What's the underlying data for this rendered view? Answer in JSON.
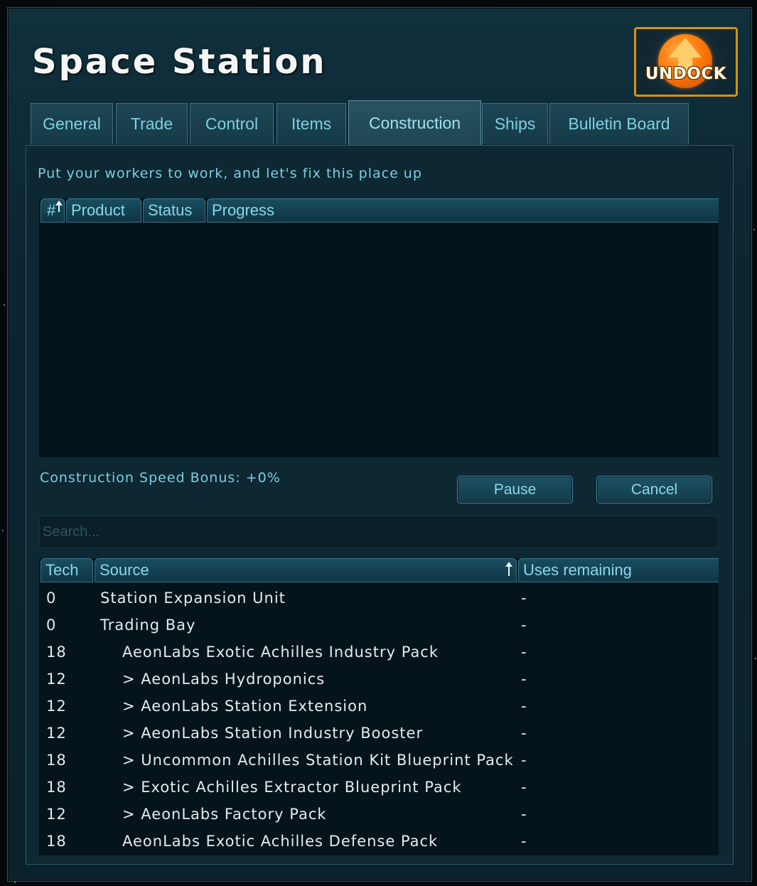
{
  "window": {
    "title": "Space Station"
  },
  "undock": {
    "label": "UNDOCK"
  },
  "tabs": [
    {
      "label": "General"
    },
    {
      "label": "Trade"
    },
    {
      "label": "Control"
    },
    {
      "label": "Items"
    },
    {
      "label": "Construction",
      "active": true
    },
    {
      "label": "Ships"
    },
    {
      "label": "Bulletin Board"
    }
  ],
  "construction": {
    "tagline": "Put your workers to work, and let's fix this place up",
    "queue_table": {
      "columns": [
        "#",
        "Product",
        "Status",
        "Progress"
      ],
      "sorted_by": "#",
      "rows": []
    },
    "speed_bonus": "Construction Speed Bonus: +0%",
    "buttons": {
      "pause": "Pause",
      "cancel": "Cancel"
    },
    "search": {
      "placeholder": "Search...",
      "value": ""
    },
    "source_table": {
      "columns": [
        "Tech",
        "Source",
        "Uses remaining"
      ],
      "sorted_by": "Source",
      "rows": [
        {
          "tech": "0",
          "source": "Station Expansion Unit",
          "indent": 0,
          "uses": "-"
        },
        {
          "tech": "0",
          "source": "Trading Bay",
          "indent": 0,
          "uses": "-"
        },
        {
          "tech": "18",
          "source": "AeonLabs Exotic Achilles Industry Pack",
          "indent": 1,
          "uses": "-"
        },
        {
          "tech": "12",
          "source": "> AeonLabs Hydroponics",
          "indent": 1,
          "uses": "-"
        },
        {
          "tech": "12",
          "source": "> AeonLabs Station Extension",
          "indent": 1,
          "uses": "-"
        },
        {
          "tech": "12",
          "source": "> AeonLabs Station Industry Booster",
          "indent": 1,
          "uses": "-"
        },
        {
          "tech": "18",
          "source": "> Uncommon Achilles Station Kit Blueprint Pack",
          "indent": 1,
          "uses": "-"
        },
        {
          "tech": "18",
          "source": "> Exotic Achilles Extractor Blueprint Pack",
          "indent": 1,
          "uses": "-"
        },
        {
          "tech": "12",
          "source": "> AeonLabs Factory Pack",
          "indent": 1,
          "uses": "-"
        },
        {
          "tech": "18",
          "source": "AeonLabs Exotic Achilles Defense Pack",
          "indent": 1,
          "uses": "-"
        }
      ]
    }
  }
}
